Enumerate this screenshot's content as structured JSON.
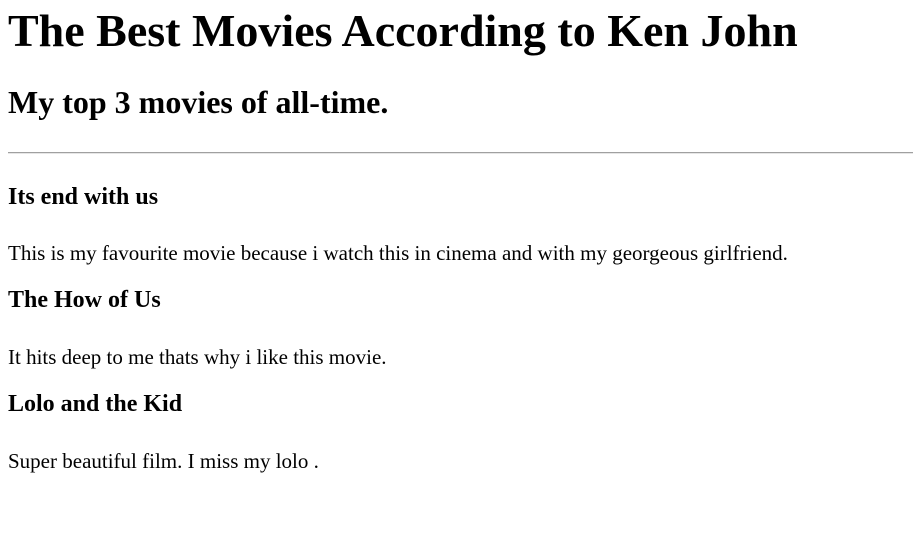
{
  "page": {
    "title": "The Best Movies According to Ken John",
    "subtitle": "My top 3 movies of all-time."
  },
  "movies": [
    {
      "name": "Its end with us",
      "reason": "This is my favourite movie because i watch this in cinema and with my georgeous girlfriend."
    },
    {
      "name": "The How of Us",
      "reason": "It hits deep to me thats why i like this movie."
    },
    {
      "name": "Lolo and the Kid",
      "reason": "Super beautiful film. I miss my lolo ."
    }
  ]
}
